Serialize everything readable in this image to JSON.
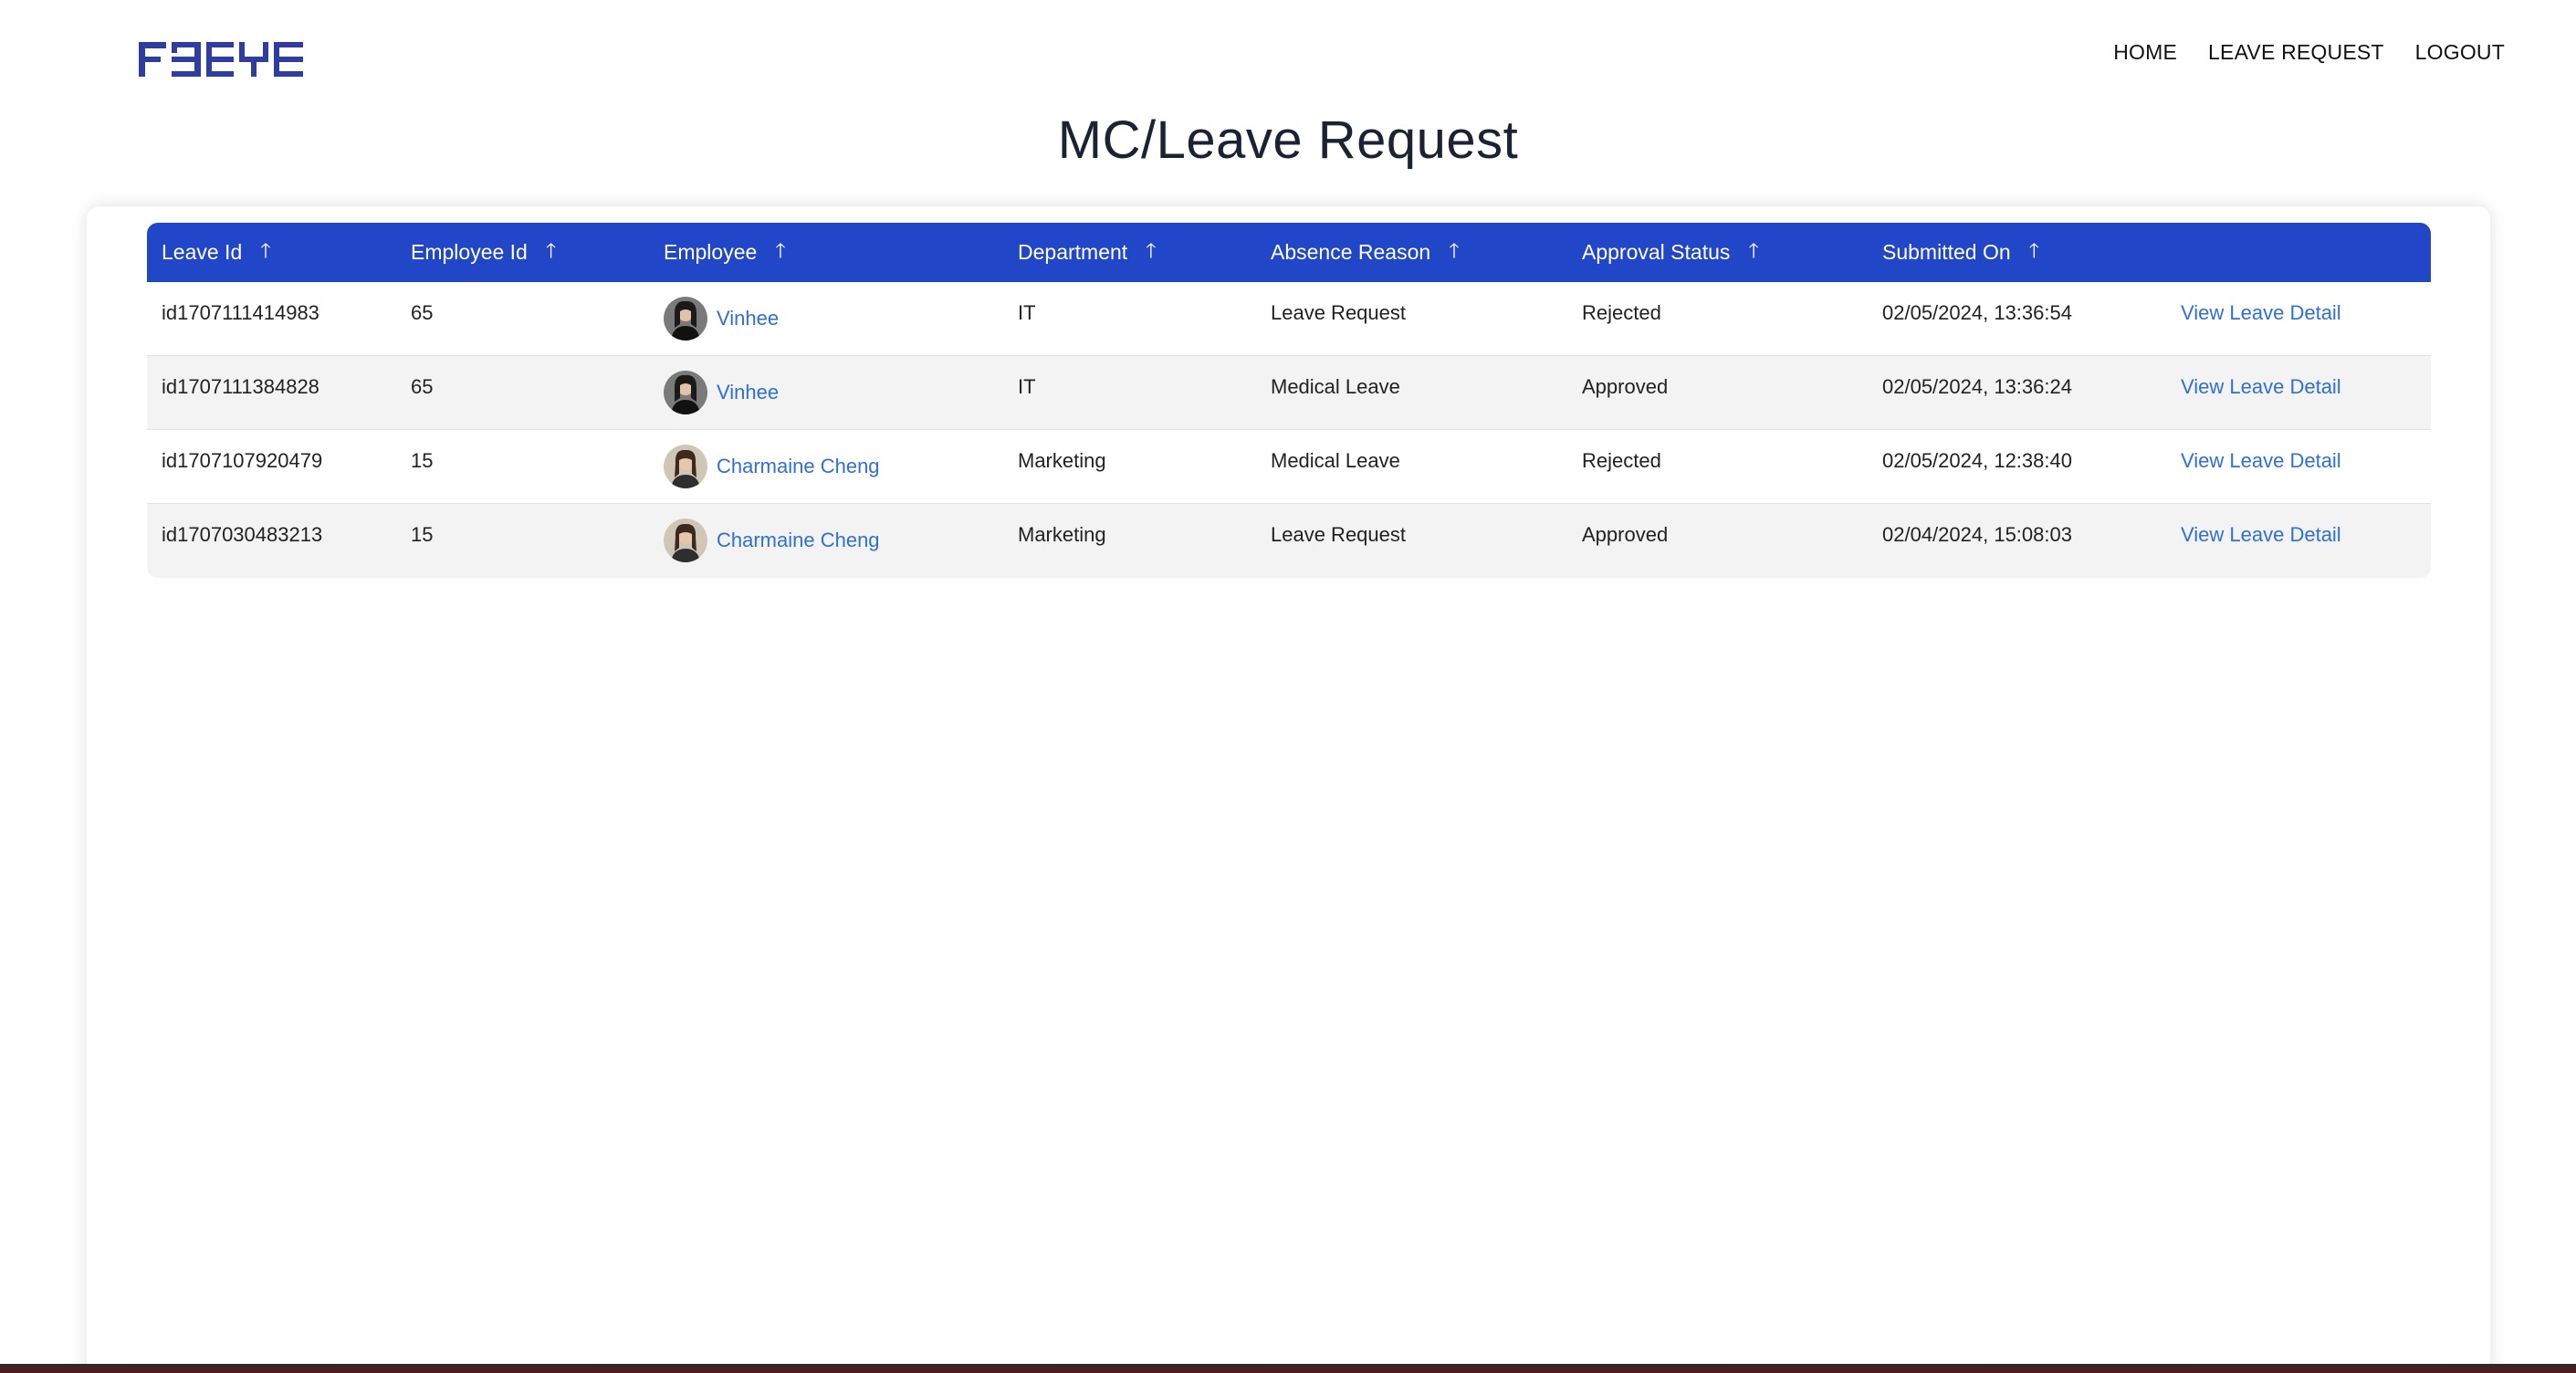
{
  "brand": {
    "logo_text": "FBEYE",
    "color": "#2f3e9e"
  },
  "nav": {
    "items": [
      "HOME",
      "LEAVE REQUEST",
      "LOGOUT"
    ]
  },
  "page": {
    "title": "MC/Leave Request"
  },
  "colors": {
    "header_bg": "#2146c7",
    "link": "#2f6fd6",
    "row_alt": "#f3f3f3"
  },
  "table": {
    "columns": [
      "Leave Id",
      "Employee Id",
      "Employee",
      "Department",
      "Absence Reason",
      "Approval Status",
      "Submitted On",
      ""
    ],
    "sort_icon": "arrow-up-icon",
    "rows": [
      {
        "leave_id": "id1707111414983",
        "employee_id": "65",
        "employee": "Vinhee",
        "avatar": "avatar-dark",
        "department": "IT",
        "reason": "Leave Request",
        "status": "Rejected",
        "submitted": "02/05/2024, 13:36:54",
        "action": "View Leave Detail"
      },
      {
        "leave_id": "id1707111384828",
        "employee_id": "65",
        "employee": "Vinhee",
        "avatar": "avatar-dark",
        "department": "IT",
        "reason": "Medical Leave",
        "status": "Approved",
        "submitted": "02/05/2024, 13:36:24",
        "action": "View Leave Detail"
      },
      {
        "leave_id": "id1707107920479",
        "employee_id": "15",
        "employee": "Charmaine Cheng",
        "avatar": "avatar-light",
        "department": "Marketing",
        "reason": "Medical Leave",
        "status": "Rejected",
        "submitted": "02/05/2024, 12:38:40",
        "action": "View Leave Detail"
      },
      {
        "leave_id": "id1707030483213",
        "employee_id": "15",
        "employee": "Charmaine Cheng",
        "avatar": "avatar-light",
        "department": "Marketing",
        "reason": "Leave Request",
        "status": "Approved",
        "submitted": "02/04/2024, 15:08:03",
        "action": "View Leave Detail"
      }
    ]
  }
}
